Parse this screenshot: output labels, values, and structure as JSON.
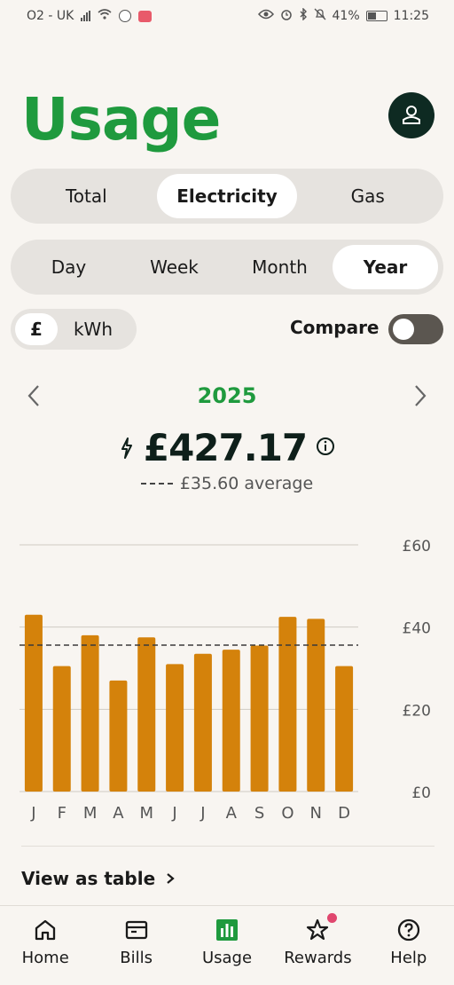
{
  "status_bar": {
    "carrier": "O2 - UK",
    "battery": "41%",
    "time": "11:25"
  },
  "header": {
    "title": "Usage"
  },
  "fuel_tabs": [
    {
      "label": "Total",
      "active": false
    },
    {
      "label": "Electricity",
      "active": true
    },
    {
      "label": "Gas",
      "active": false
    }
  ],
  "period_tabs": [
    {
      "label": "Day",
      "active": false
    },
    {
      "label": "Week",
      "active": false
    },
    {
      "label": "Month",
      "active": false
    },
    {
      "label": "Year",
      "active": true
    }
  ],
  "unit_toggle": {
    "pound": "£",
    "kwh": "kWh",
    "selected": "£"
  },
  "compare": {
    "label": "Compare",
    "enabled": false
  },
  "period": {
    "year": "2025"
  },
  "summary": {
    "total": "£427.17",
    "average": "£35.60 average"
  },
  "chart_data": {
    "type": "bar",
    "categories": [
      "J",
      "F",
      "M",
      "A",
      "M",
      "J",
      "J",
      "A",
      "S",
      "O",
      "N",
      "D"
    ],
    "values": [
      43,
      30.5,
      38,
      27,
      37.5,
      31,
      33.5,
      34.5,
      35.5,
      42.5,
      42,
      30.5
    ],
    "average": 35.6,
    "y_ticks": [
      "£0",
      "£20",
      "£40",
      "£60"
    ],
    "y_tick_values": [
      0,
      20,
      40,
      60
    ],
    "ylim": [
      0,
      60
    ],
    "bar_color": "#d4820b",
    "grid": true
  },
  "view_table": {
    "label": "View as table"
  },
  "bottom_nav": [
    {
      "label": "Home",
      "icon": "home-icon",
      "active": false
    },
    {
      "label": "Bills",
      "icon": "bills-icon",
      "active": false
    },
    {
      "label": "Usage",
      "icon": "usage-icon",
      "active": true
    },
    {
      "label": "Rewards",
      "icon": "rewards-icon",
      "active": false,
      "badge": true
    },
    {
      "label": "Help",
      "icon": "help-icon",
      "active": false
    }
  ],
  "colors": {
    "brand_green": "#1f9a3e",
    "bar": "#d4820b",
    "background": "#f8f5f1",
    "badge": "#e0466e"
  }
}
